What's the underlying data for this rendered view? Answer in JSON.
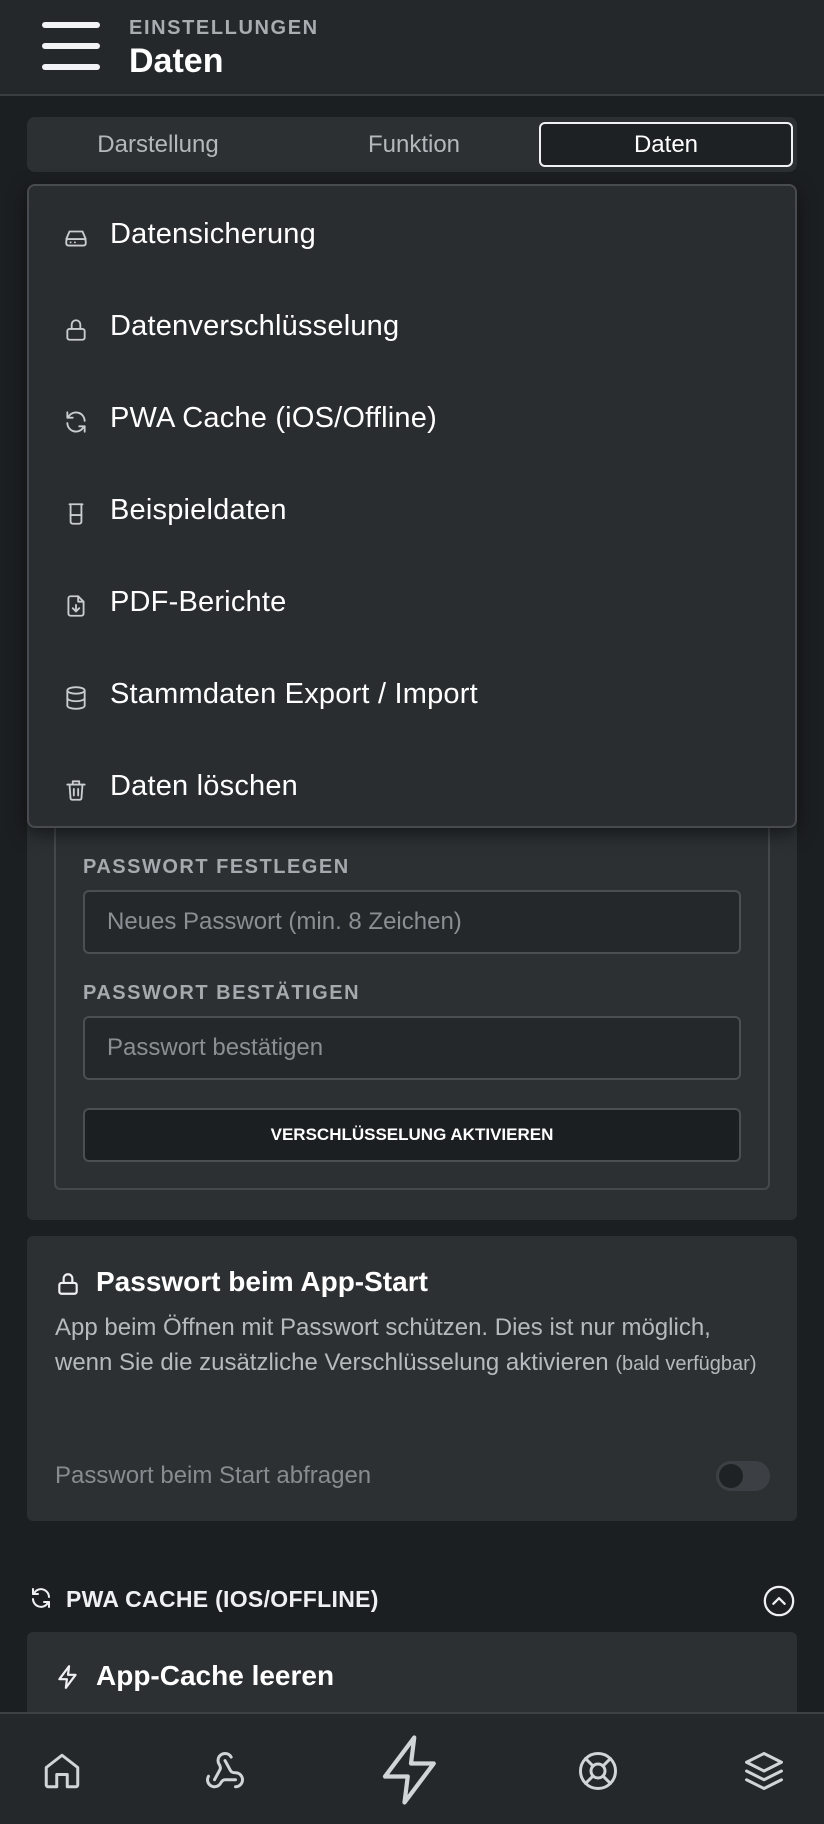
{
  "header": {
    "section_label": "EINSTELLUNGEN",
    "title": "Daten",
    "menu_icon": "hamburger-menu-icon"
  },
  "tabs": [
    {
      "label": "Darstellung",
      "active": false
    },
    {
      "label": "Funktion",
      "active": false
    },
    {
      "label": "Daten",
      "active": true
    }
  ],
  "dropdown": {
    "items": [
      {
        "label": "Datensicherung",
        "icon": "hard-drive-icon"
      },
      {
        "label": "Datenverschlüsselung",
        "icon": "lock-icon"
      },
      {
        "label": "PWA Cache (iOS/Offline)",
        "icon": "refresh-icon"
      },
      {
        "label": "Beispieldaten",
        "icon": "beaker-icon"
      },
      {
        "label": "PDF-Berichte",
        "icon": "file-download-icon"
      },
      {
        "label": "Stammdaten Export / Import",
        "icon": "database-icon"
      },
      {
        "label": "Daten löschen",
        "icon": "trash-icon"
      }
    ]
  },
  "encryption": {
    "password_label": "PASSWORT FESTLEGEN",
    "password_placeholder": "Neues Passwort (min. 8 Zeichen)",
    "confirm_label": "PASSWORT BESTÄTIGEN",
    "confirm_placeholder": "Passwort bestätigen",
    "activate_button": "VERSCHLÜSSELUNG AKTIVIEREN"
  },
  "app_start": {
    "title": "Passwort beim App-Start",
    "description": "App beim Öffnen mit Passwort schützen. Dies ist nur möglich, wenn Sie die zusätzliche Verschlüsselung aktivieren",
    "note": "(bald verfügbar)",
    "toggle_label": "Passwort beim Start abfragen",
    "toggle_on": false
  },
  "pwa_cache": {
    "heading": "PWA CACHE (IOS/OFFLINE)",
    "card_title": "App-Cache leeren"
  },
  "bottom_nav": [
    {
      "icon": "home-icon"
    },
    {
      "icon": "webhook-icon"
    },
    {
      "icon": "lightning-bolt-icon"
    },
    {
      "icon": "lifebuoy-icon"
    },
    {
      "icon": "layers-icon"
    }
  ],
  "colors": {
    "background": "#1c1f21",
    "surface": "#2c3033",
    "text": "#eef0f1",
    "muted": "#a9adb1"
  }
}
